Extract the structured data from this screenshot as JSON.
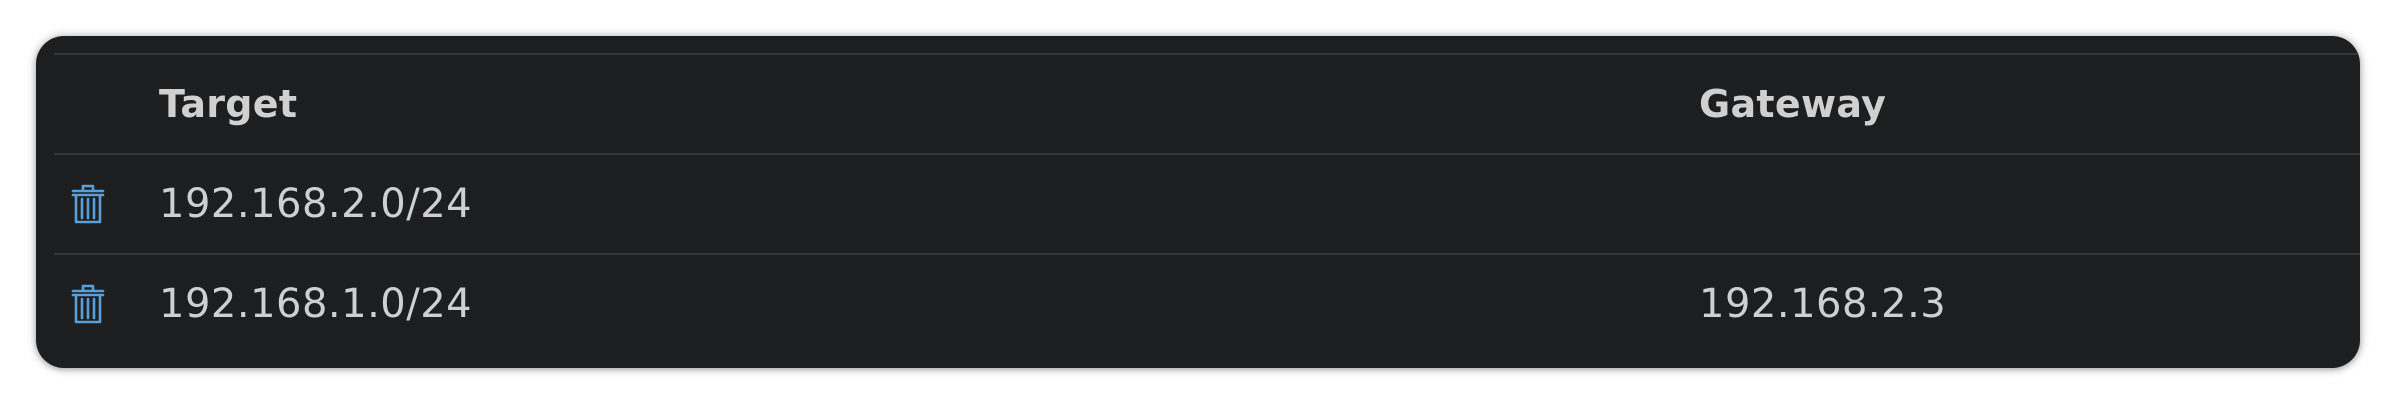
{
  "table": {
    "headers": {
      "target": "Target",
      "gateway": "Gateway"
    },
    "rows": [
      {
        "target": "192.168.2.0/24",
        "gateway": "",
        "action_icon": "trash-icon"
      },
      {
        "target": "192.168.1.0/24",
        "gateway": "192.168.2.3",
        "action_icon": "trash-icon"
      }
    ]
  },
  "colors": {
    "panel_background": "#1c1e20",
    "divider": "#34373a",
    "text": "#cfcfcf",
    "icon_accent": "#5a9fd8"
  }
}
